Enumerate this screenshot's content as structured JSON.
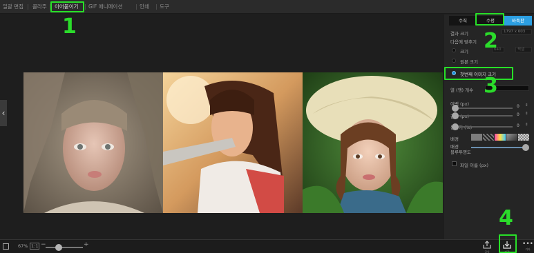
{
  "menu": [
    {
      "label": "일괄 편집"
    },
    {
      "label": "콜라주"
    },
    {
      "label": "이어붙이기"
    },
    {
      "label": "GIF 애니메이션"
    },
    {
      "label": "인쇄"
    },
    {
      "label": "도구"
    }
  ],
  "panel": {
    "tabs": [
      "수직",
      "수평",
      "바둑판"
    ],
    "result_size_label": "결과 크기",
    "result_size_value": "1797 x 603",
    "fit_label": "다음에 맞추기",
    "size_label": "크기",
    "size_field_placeholder": "640",
    "size_unit_placeholder": "픽셀",
    "original_label": "원본 크기",
    "first_image_label": "첫번째 이미지 크기",
    "columns_label": "열 (행) 개수",
    "margin_label": "여백 (px)",
    "margin_value": "0",
    "spacing_label": "간격 (px)",
    "spacing_value": "0",
    "round_label": "둥글기 (%)",
    "round_value": "0",
    "background_label": "배경",
    "bg_blur_label": "배경",
    "bg_blur_label2": "블루투명도",
    "filename_label": "파일 이름 (px)"
  },
  "bottom": {
    "zoom": "67%",
    "one_to_one": "1:1",
    "minus": "−",
    "plus": "+",
    "share_label": "공유",
    "save_label": "저장",
    "more_label": "기타",
    "zoom_level": 0.35
  },
  "annotations": [
    "1",
    "2",
    "3",
    "4"
  ],
  "colors": {
    "accent": "#2c9fe2",
    "highlight": "#28e028"
  },
  "icons": {
    "left_arrow": "chevron-left-icon",
    "share": "share-icon",
    "save": "download-icon",
    "more": "more-icon",
    "layout": "layout-icon"
  }
}
